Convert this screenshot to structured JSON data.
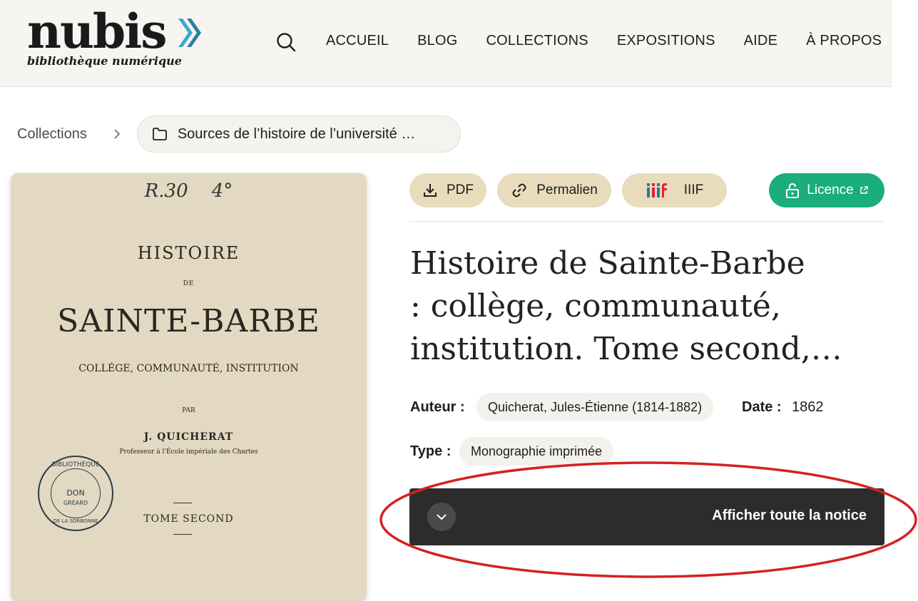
{
  "header": {
    "logo_word": "nubis",
    "logo_sub": "bibliothèque numérique",
    "nav": [
      "ACCUEIL",
      "BLOG",
      "COLLECTIONS",
      "EXPOSITIONS",
      "AIDE",
      "À PROPOS"
    ]
  },
  "breadcrumb": {
    "root": "Collections",
    "current": "Sources de l’histoire de l’université …"
  },
  "cover": {
    "shelfmark": "R.30",
    "shelfmark2": "4°",
    "line1": "HISTOIRE",
    "line2": "DE",
    "line3": "SAINTE-BARBE",
    "line4": "COLLÉGE, COMMUNAUTÉ, INSTITUTION",
    "line5": "PAR",
    "line6": "J. QUICHERAT",
    "line7": "Professeur à l'École impériale des Chartes",
    "line8": "TOME SECOND",
    "stamp_top": "BIBLIOTHÈQUE",
    "stamp_mid": "DON",
    "stamp_right": "GRÉARD",
    "stamp_bottom": "DE LA SORBONNE"
  },
  "toolbar": {
    "pdf": "PDF",
    "permalink": "Permalien",
    "iiif": "IIIF",
    "license": "Licence"
  },
  "record": {
    "title_lines": [
      "Histoire de Sainte-Barbe",
      ": collège, communauté,",
      "institution. Tome second,…"
    ],
    "author_label": "Auteur :",
    "author": "Quicherat, Jules-Étienne (1814-1882)",
    "date_label": "Date :",
    "date": "1862",
    "type_label": "Type :",
    "type": "Monographie imprimée"
  },
  "expand": {
    "label": "Afficher toute la notice"
  },
  "colors": {
    "accent_beige": "#e8dcbc",
    "license_green": "#1aae7e",
    "expand_bg": "#2c2c2c",
    "annotation_red": "#d42121"
  }
}
